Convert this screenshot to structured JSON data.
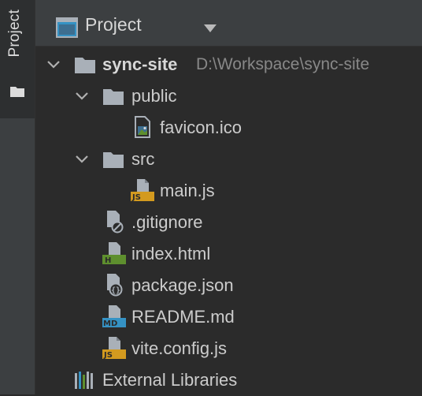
{
  "sidebar": {
    "tab_label": "Project",
    "tab_icon": "folder-icon"
  },
  "header": {
    "title": "Project",
    "icon": "project-window-icon",
    "dropdown_icon": "caret-down-icon"
  },
  "tree": {
    "root": {
      "name": "sync-site",
      "path": "D:\\Workspace\\sync-site",
      "expanded": true
    },
    "public_folder": {
      "name": "public",
      "expanded": true
    },
    "favicon": {
      "name": "favicon.ico",
      "icon": "image-file-icon"
    },
    "src_folder": {
      "name": "src",
      "expanded": true
    },
    "main_js": {
      "name": "main.js",
      "icon": "js-file-icon",
      "badge": "JS"
    },
    "gitignore": {
      "name": ".gitignore",
      "icon": "ignore-file-icon"
    },
    "index_html": {
      "name": "index.html",
      "icon": "html-file-icon",
      "badge": "H"
    },
    "package_json": {
      "name": "package.json",
      "icon": "json-file-icon"
    },
    "readme": {
      "name": "README.md",
      "icon": "markdown-file-icon",
      "badge": "MD"
    },
    "vite_config": {
      "name": "vite.config.js",
      "icon": "js-file-icon",
      "badge": "JS"
    },
    "external_libraries": {
      "name": "External Libraries",
      "icon": "libraries-icon"
    }
  },
  "colors": {
    "background": "#2b2b2b",
    "panel": "#3c3f41",
    "folder": "#a9b0b8",
    "js_badge": "#d39a1f",
    "html_badge": "#5e8f2e",
    "md_badge": "#3592c4"
  }
}
